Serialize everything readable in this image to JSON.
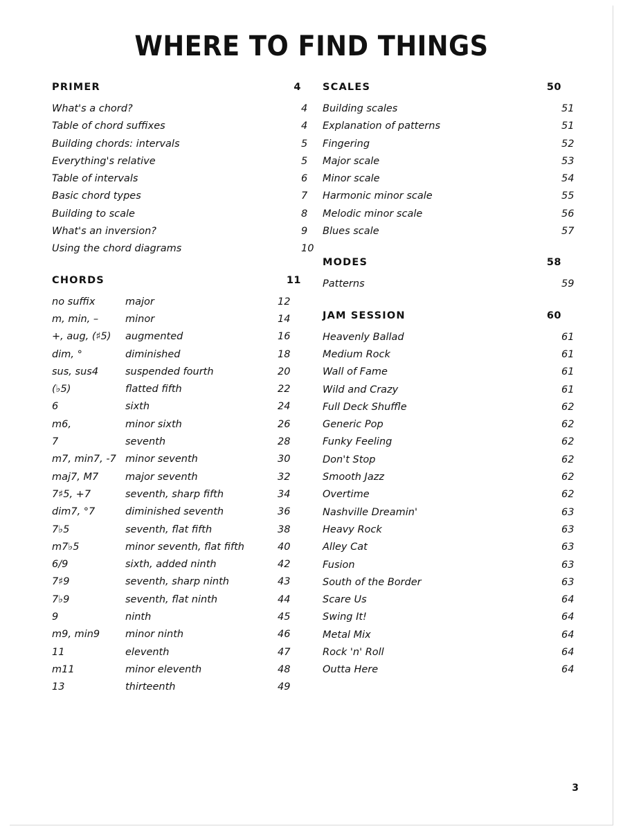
{
  "page": {
    "title": "WHERE TO FIND THINGS",
    "folio": "3"
  },
  "left_column": {
    "primer": {
      "heading": "PRIMER",
      "page": "4",
      "entries": [
        {
          "label": "What's a chord?",
          "page": "4"
        },
        {
          "label": "Table of chord suffixes",
          "page": "4"
        },
        {
          "label": "Building chords: intervals",
          "page": "5"
        },
        {
          "label": "Everything's relative",
          "page": "5"
        },
        {
          "label": "Table of intervals",
          "page": "6"
        },
        {
          "label": "Basic chord types",
          "page": "7"
        },
        {
          "label": "Building to scale",
          "page": "8"
        },
        {
          "label": "What's an inversion?",
          "page": "9"
        },
        {
          "label": "Using the chord diagrams",
          "page": "10"
        }
      ]
    },
    "chords": {
      "heading": "CHORDS",
      "page": "11",
      "entries": [
        {
          "suffix": "no suffix",
          "name": "major",
          "page": "12"
        },
        {
          "suffix": "m, min, –",
          "name": "minor",
          "page": "14"
        },
        {
          "suffix": "+, aug, (♯5)",
          "name": "augmented",
          "page": "16"
        },
        {
          "suffix": "dim, °",
          "name": "diminished",
          "page": "18"
        },
        {
          "suffix": "sus, sus4",
          "name": "suspended fourth",
          "page": "20"
        },
        {
          "suffix": "(♭5)",
          "name": "flatted fifth",
          "page": "22"
        },
        {
          "suffix": "6",
          "name": "sixth",
          "page": "24"
        },
        {
          "suffix": "m6,",
          "name": "minor sixth",
          "page": "26"
        },
        {
          "suffix": "7",
          "name": "seventh",
          "page": "28"
        },
        {
          "suffix": "m7, min7, -7",
          "name": "minor seventh",
          "page": "30"
        },
        {
          "suffix": "maj7, M7",
          "name": "major seventh",
          "page": "32"
        },
        {
          "suffix": "7♯5, +7",
          "name": "seventh, sharp fifth",
          "page": "34"
        },
        {
          "suffix": "dim7, °7",
          "name": "diminished seventh",
          "page": "36"
        },
        {
          "suffix": "7♭5",
          "name": "seventh, flat fifth",
          "page": "38"
        },
        {
          "suffix": "m7♭5",
          "name": "minor seventh, flat fifth",
          "page": "40"
        },
        {
          "suffix": "6/9",
          "name": "sixth, added ninth",
          "page": "42"
        },
        {
          "suffix": "7♯9",
          "name": "seventh, sharp ninth",
          "page": "43"
        },
        {
          "suffix": "7♭9",
          "name": "seventh, flat ninth",
          "page": "44"
        },
        {
          "suffix": "9",
          "name": "ninth",
          "page": "45"
        },
        {
          "suffix": "m9, min9",
          "name": "minor ninth",
          "page": "46"
        },
        {
          "suffix": "11",
          "name": "eleventh",
          "page": "47"
        },
        {
          "suffix": "m11",
          "name": "minor eleventh",
          "page": "48"
        },
        {
          "suffix": "13",
          "name": "thirteenth",
          "page": "49"
        }
      ]
    }
  },
  "right_column": {
    "scales": {
      "heading": "SCALES",
      "page": "50",
      "entries": [
        {
          "label": "Building scales",
          "page": "51"
        },
        {
          "label": "Explanation of patterns",
          "page": "51"
        },
        {
          "label": "Fingering",
          "page": "52"
        },
        {
          "label": "Major scale",
          "page": "53"
        },
        {
          "label": "Minor scale",
          "page": "54"
        },
        {
          "label": "Harmonic minor scale",
          "page": "55"
        },
        {
          "label": "Melodic minor scale",
          "page": "56"
        },
        {
          "label": "Blues scale",
          "page": "57"
        }
      ]
    },
    "modes": {
      "heading": "MODES",
      "page": "58",
      "entries": [
        {
          "label": "Patterns",
          "page": "59"
        }
      ]
    },
    "jam_session": {
      "heading": "JAM SESSION",
      "page": "60",
      "entries": [
        {
          "label": "Heavenly Ballad",
          "page": "61"
        },
        {
          "label": "Medium Rock",
          "page": "61"
        },
        {
          "label": "Wall of Fame",
          "page": "61"
        },
        {
          "label": "Wild and Crazy",
          "page": "61"
        },
        {
          "label": "Full Deck Shuffle",
          "page": "62"
        },
        {
          "label": "Generic Pop",
          "page": "62"
        },
        {
          "label": "Funky Feeling",
          "page": "62"
        },
        {
          "label": "Don't Stop",
          "page": "62"
        },
        {
          "label": "Smooth Jazz",
          "page": "62"
        },
        {
          "label": "Overtime",
          "page": "62"
        },
        {
          "label": "Nashville Dreamin'",
          "page": "63"
        },
        {
          "label": "Heavy Rock",
          "page": "63"
        },
        {
          "label": "Alley Cat",
          "page": "63"
        },
        {
          "label": "Fusion",
          "page": "63"
        },
        {
          "label": "South of the Border",
          "page": "63"
        },
        {
          "label": "Scare Us",
          "page": "64"
        },
        {
          "label": "Swing It!",
          "page": "64"
        },
        {
          "label": "Metal Mix",
          "page": "64"
        },
        {
          "label": "Rock 'n' Roll",
          "page": "64"
        },
        {
          "label": "Outta Here",
          "page": "64"
        }
      ]
    }
  }
}
